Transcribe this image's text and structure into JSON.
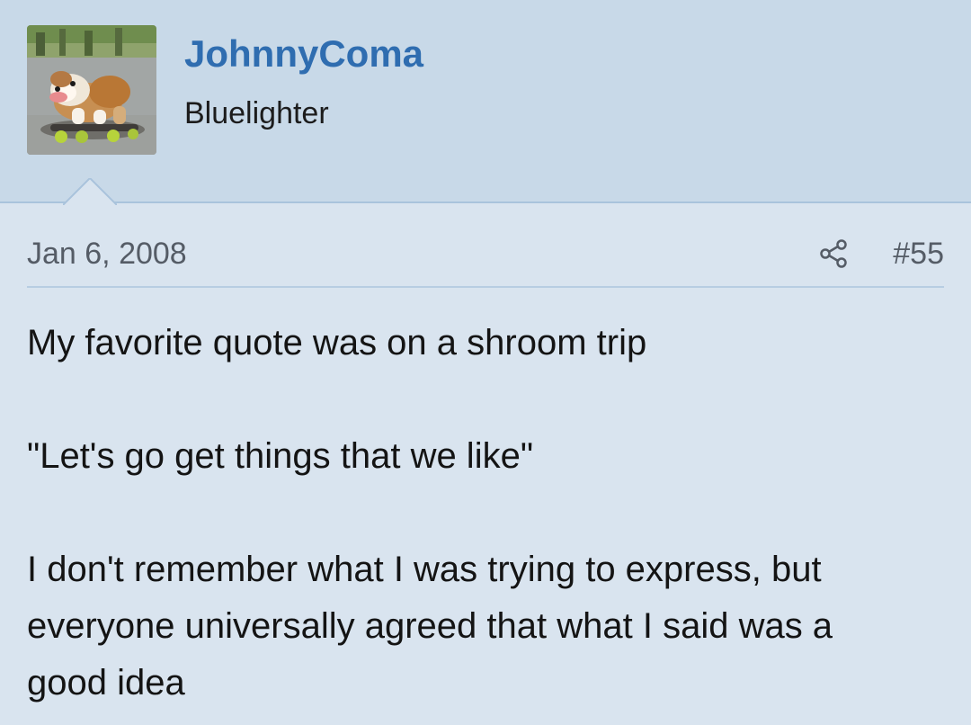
{
  "user": {
    "name": "JohnnyComa",
    "title": "Bluelighter"
  },
  "meta": {
    "date": "Jan 6, 2008",
    "post_number": "#55",
    "share_icon": "share-icon"
  },
  "message": {
    "line1": "My favorite quote was on a shroom trip",
    "line2": "\"Let's go get things that we like\"",
    "line3": "I don't remember what I was trying to express, but",
    "line4": "everyone universally agreed that what I said was a",
    "line5": "good idea"
  },
  "colors": {
    "username": "#2f6db0",
    "header_bg": "#c8d9e8",
    "body_bg": "#d9e4ef",
    "meta_text": "#555c66",
    "divider": "#b7cde2"
  }
}
